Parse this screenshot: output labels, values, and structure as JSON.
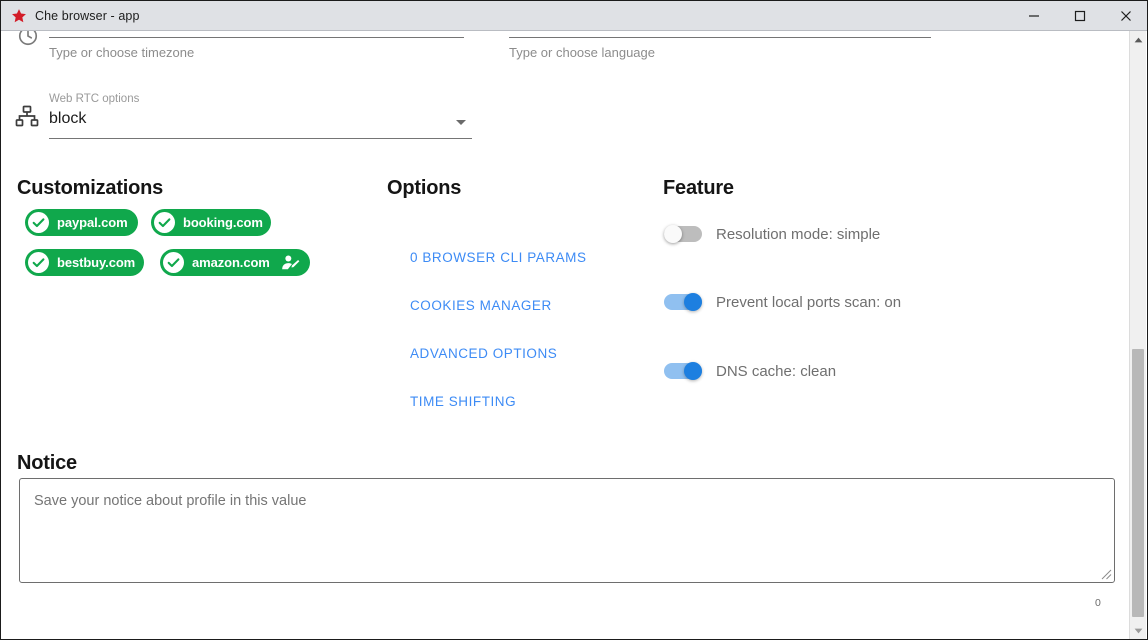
{
  "window": {
    "title": "Che browser - app",
    "icon": "star-icon",
    "controls": {
      "minimize": "minimize-icon",
      "maximize": "maximize-icon",
      "close": "close-icon"
    }
  },
  "form": {
    "timezone": {
      "hint": "Type or choose timezone"
    },
    "language": {
      "hint": "Type or choose language"
    },
    "webrtc": {
      "icon": "device-hub-icon",
      "label": "Web RTC options",
      "value": "block",
      "arrow": "dropdown-arrow-icon"
    }
  },
  "customizations": {
    "title": "Customizations",
    "chips": [
      {
        "label": "paypal.com",
        "icon": "check-circle-icon",
        "action": null
      },
      {
        "label": "booking.com",
        "icon": "check-circle-icon",
        "action": null
      },
      {
        "label": "bestbuy.com",
        "icon": "check-circle-icon",
        "action": null
      },
      {
        "label": "amazon.com",
        "icon": "check-circle-icon",
        "action": "edit-profile-icon"
      }
    ],
    "chip_color": "#10a84c"
  },
  "options": {
    "title": "Options",
    "links": [
      "0 BROWSER CLI PARAMS",
      "COOKIES MANAGER",
      "ADVANCED OPTIONS",
      "TIME SHIFTING"
    ],
    "link_color": "#3d8bf5"
  },
  "feature": {
    "title": "Feature",
    "toggles": [
      {
        "label": "Resolution mode: simple",
        "on": false
      },
      {
        "label": "Prevent local ports scan: on",
        "on": true
      },
      {
        "label": "DNS cache: clean",
        "on": true
      }
    ],
    "on_color": "#1d7fe0",
    "off_color": "#bdbdbd"
  },
  "notice": {
    "title": "Notice",
    "placeholder": "Save your notice about profile in this value",
    "value": "",
    "char_count": "0"
  },
  "scrollbar": {
    "up_arrow": "scroll-up-icon",
    "down_arrow": "scroll-down-icon"
  }
}
